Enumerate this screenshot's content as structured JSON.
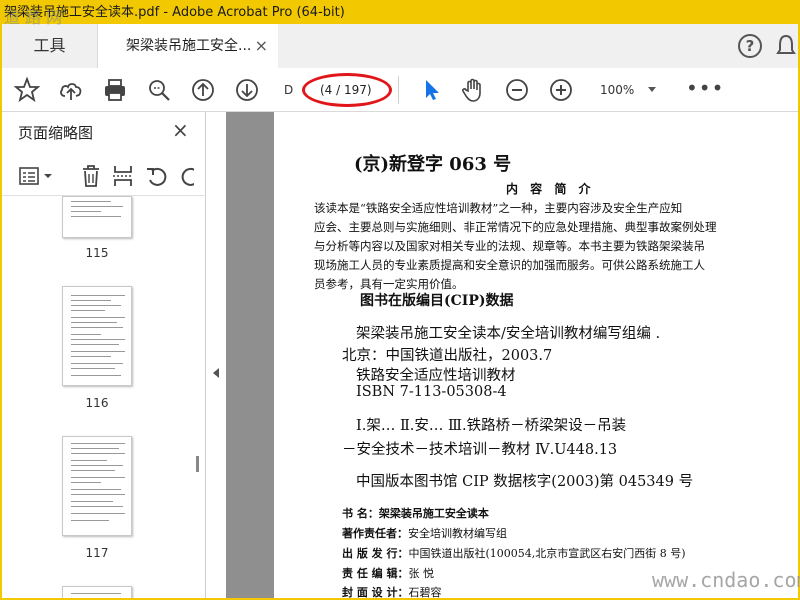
{
  "window": {
    "title": "架梁装吊施工安全读本.pdf - Adobe Acrobat Pro (64-bit)",
    "frame_color": "#f2c800"
  },
  "tabs": {
    "tools_label": "工具",
    "document_label": "架梁装吊施工安全...",
    "close_glyph": "×",
    "help_glyph": "?"
  },
  "toolbar": {
    "icons": [
      "star-icon",
      "cloud-upload-icon",
      "print-icon",
      "zoom-search-icon",
      "arrow-up-circle-icon",
      "arrow-down-circle-icon",
      "cursor-arrow-icon",
      "hand-icon",
      "zoom-out-icon",
      "zoom-in-icon"
    ],
    "page_input": "D",
    "page_count": "(4 / 197)",
    "zoom": "100%",
    "more": "•••",
    "highlight_color": "#e0161b",
    "accent_color": "#1473e6"
  },
  "sidebar": {
    "title": "页面缩略图",
    "close_glyph": "×",
    "tool_icons": [
      "thumbnail-options-icon",
      "trash-icon",
      "insert-page-icon",
      "undo-icon",
      "redo-icon"
    ],
    "thumbnails": [
      {
        "label": "115"
      },
      {
        "label": "116"
      },
      {
        "label": "117"
      }
    ]
  },
  "document": {
    "heading": "(京)新登字 063 号",
    "subheading": "内 容 简 介",
    "paragraph_lines": [
      "该读本是“铁路安全适应性培训教材”之一种，主要内容涉及安全生产应知",
      "应会、主要总则与实施细则、非正常情况下的应急处理措施、典型事故案例处理",
      "与分析等内容以及国家对相关专业的法规、规章等。本书主要为铁路架梁装吊",
      "现场施工人员的专业素质提高和安全意识的加强而服务。可供公路系统施工人",
      "员参考，具有一定实用价值。"
    ],
    "cip_title": "图书在版编目(CIP)数据",
    "cip_lines": [
      "架梁装吊施工安全读本/安全培训教材编写组编 .",
      "北京：中国铁道出版社，2003.7",
      "铁路安全适应性培训教材",
      "ISBN 7-113-05308-4",
      "Ⅰ.架…    Ⅱ.安…    Ⅲ.铁路桥－桥梁架设－吊装",
      "－安全技术－技术培训－教材   Ⅳ.U448.13",
      "中国版本图书馆 CIP 数据核字(2003)第 045349 号"
    ],
    "meta": [
      {
        "key": "书      名：",
        "value": "架梁装吊施工安全读本"
      },
      {
        "key": "著作责任者：",
        "value": "安全培训教材编写组"
      },
      {
        "key": "出 版 发 行：",
        "value": "中国铁道出版社(100054,北京市宣武区右安门西街 8 号)"
      },
      {
        "key": "责 任 编 辑：",
        "value": "张   悦"
      },
      {
        "key": "封 面 设 计：",
        "value": "石碧容"
      }
    ]
  },
  "watermarks": {
    "top_left": "道 路 网",
    "bottom_right": "www.cndao.com"
  }
}
